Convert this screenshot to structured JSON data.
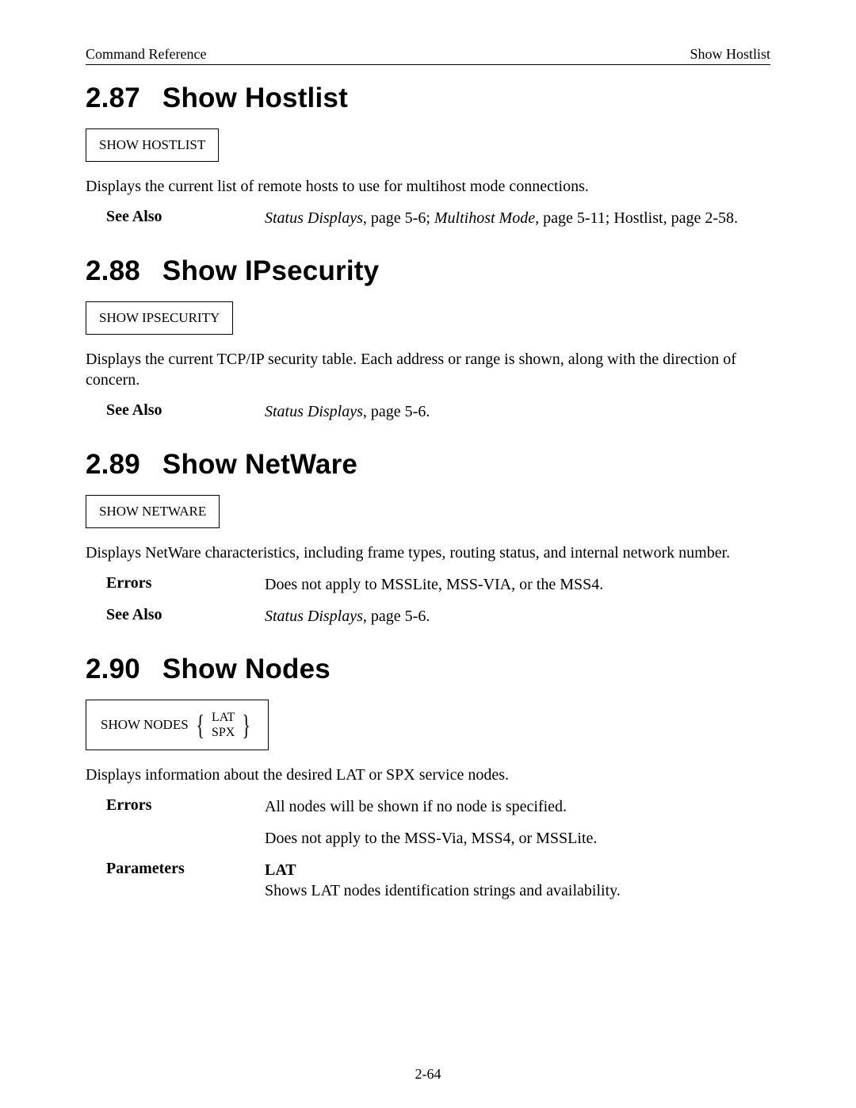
{
  "header": {
    "left": "Command Reference",
    "right": "Show Hostlist"
  },
  "sections": {
    "s287": {
      "num": "2.87",
      "title": "Show Hostlist",
      "syntax": "SHOW HOSTLIST",
      "description": "Displays the current list of remote hosts to use for multihost mode connections.",
      "seeAlsoLabel": "See Also",
      "seeAlso_italic1": "Status Displays",
      "seeAlso_plain1": ", page 5-6; ",
      "seeAlso_italic2": "Multihost Mode",
      "seeAlso_plain2": ", page 5-11; Hostlist, page 2-58."
    },
    "s288": {
      "num": "2.88",
      "title": "Show IPsecurity",
      "syntax": "SHOW IPSECURITY",
      "description": "Displays the current TCP/IP security table. Each address or range is shown, along with the direction of concern.",
      "seeAlsoLabel": "See Also",
      "seeAlso_italic1": "Status Displays",
      "seeAlso_plain1": ", page 5-6."
    },
    "s289": {
      "num": "2.89",
      "title": "Show NetWare",
      "syntax": "SHOW NETWARE",
      "description": "Displays NetWare characteristics, including frame types, routing status, and internal network number.",
      "errorsLabel": "Errors",
      "errors": "Does not apply to MSSLite, MSS-VIA, or the MSS4.",
      "seeAlsoLabel": "See Also",
      "seeAlso_italic1": "Status Displays",
      "seeAlso_plain1": ", page 5-6."
    },
    "s290": {
      "num": "2.90",
      "title": "Show Nodes",
      "syntax_prefix": "SHOW NODES",
      "syntax_opt1": "LAT",
      "syntax_opt2": "SPX",
      "description": "Displays information about the desired LAT or SPX service nodes.",
      "errorsLabel": "Errors",
      "errors1": "All nodes will be shown if no node is specified.",
      "errors2": "Does not apply to the MSS-Via, MSS4, or MSSLite.",
      "parametersLabel": "Parameters",
      "param_term": "LAT",
      "param_desc": "Shows LAT nodes identification strings and availability."
    }
  },
  "pageNumber": "2-64"
}
